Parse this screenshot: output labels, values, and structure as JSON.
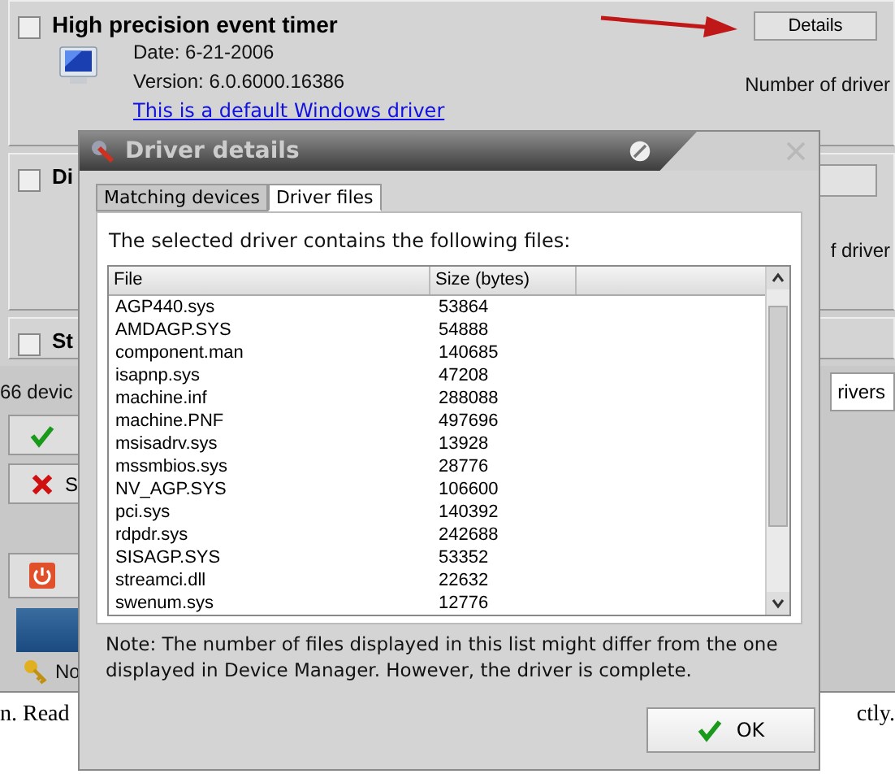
{
  "background_window": {
    "devices": [
      {
        "name": "High precision event timer",
        "checked": false,
        "date": "Date: 6-21-2006",
        "version": "Version: 6.0.6000.16386",
        "note": "This is a default Windows driver",
        "button": "Details",
        "driver_count_label": "Number of driver"
      },
      {
        "name": "Di",
        "checked": false,
        "driver_count_label": "f driver"
      },
      {
        "name": "St",
        "checked": false
      }
    ],
    "device_count": "66 devic",
    "filter_value": "rivers",
    "buttons": [
      {
        "kind": "check"
      },
      {
        "kind": "cross",
        "label": "S"
      },
      {
        "kind": "power"
      }
    ],
    "tree_item": "No",
    "text_left": "n. Read",
    "text_right": "ctly."
  },
  "dialog": {
    "title": "Driver details",
    "tabs": [
      {
        "label": "Matching devices",
        "selected": false
      },
      {
        "label": "Driver files",
        "selected": true
      }
    ],
    "heading": "The selected driver contains the following files:",
    "table": {
      "columns": [
        "File",
        "Size (bytes)"
      ],
      "rows": [
        [
          "AGP440.sys",
          "53864"
        ],
        [
          "AMDAGP.SYS",
          "54888"
        ],
        [
          "component.man",
          "140685"
        ],
        [
          "isapnp.sys",
          "47208"
        ],
        [
          "machine.inf",
          "288088"
        ],
        [
          "machine.PNF",
          "497696"
        ],
        [
          "msisadrv.sys",
          "13928"
        ],
        [
          "mssmbios.sys",
          "28776"
        ],
        [
          "NV_AGP.SYS",
          "106600"
        ],
        [
          "pci.sys",
          "140392"
        ],
        [
          "rdpdr.sys",
          "242688"
        ],
        [
          "SISAGP.SYS",
          "53352"
        ],
        [
          "streamci.dll",
          "22632"
        ],
        [
          "swenum.sys",
          "12776"
        ]
      ]
    },
    "note": "Note: The number of files displayed in this list might differ from the one displayed in Device Manager. However, the driver is complete.",
    "ok_button": "OK"
  }
}
